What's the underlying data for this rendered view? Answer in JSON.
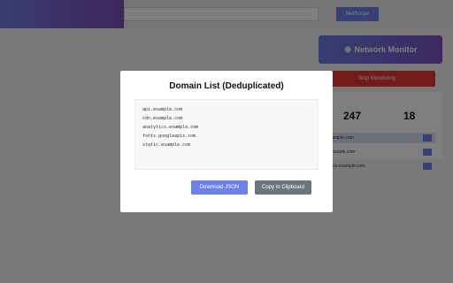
{
  "header": {
    "url_value": "",
    "netscope_label": "NetScope"
  },
  "monitor": {
    "title": "Network Monitor",
    "stop_label": "Stop Monitoring",
    "stat_a": "247",
    "stat_b": "18",
    "rows": [
      "api.example.com",
      "cdn.example.com",
      "analytics.example.com"
    ]
  },
  "modal": {
    "title": "Domain List (Deduplicated)",
    "domains": [
      "api.example.com",
      "cdn.example.com",
      "analytics.example.com",
      "fonts.googleapis.com",
      "static.example.com"
    ],
    "download_label": "Download JSON",
    "copy_label": "Copy to Clipboard"
  },
  "colors": {
    "accent": "#6b80e8",
    "danger": "#e53935",
    "secondary": "#6c757d"
  }
}
